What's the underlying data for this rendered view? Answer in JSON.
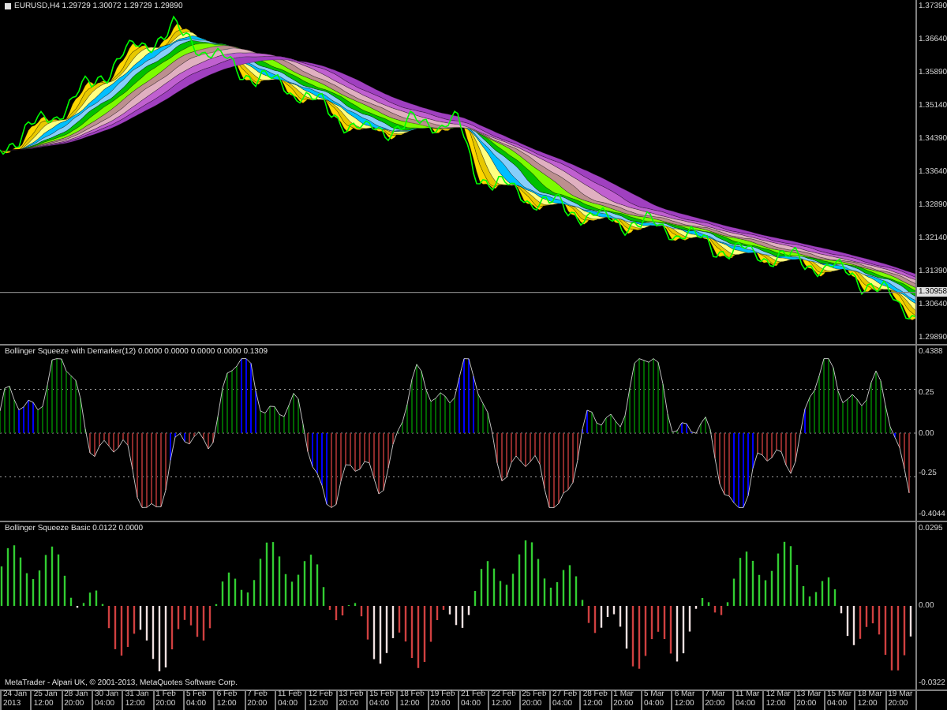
{
  "chart_window": {
    "title": "EURUSD,H4 1.29729 1.30072 1.29729 1.29890"
  },
  "panels": [
    {
      "kind": "price",
      "axis_labels": [
        "1.37390",
        "1.36640",
        "1.35890",
        "1.35140",
        "1.34390",
        "1.33640",
        "1.32890",
        "1.32140",
        "1.31390",
        "1.30640",
        "1.29890"
      ],
      "price_tag": "1.30958"
    },
    {
      "kind": "oscillator",
      "label": "Bollinger Squeeze with Demarker(12) 0.0000 0.0000 0.0000 0.0000 0.1309",
      "axis_labels": [
        "0.4388",
        "0.25",
        "0.00",
        "-0.25",
        "-0.4044"
      ]
    },
    {
      "kind": "histogram",
      "label": "Bollinger Squeeze Basic 0.0122 0.0000",
      "axis_labels": [
        "0.0295",
        "0.00",
        "-0.0322"
      ],
      "footer": "MetaTrader - Alpari UK, © 2001-2013, MetaQuotes Software Corp."
    }
  ],
  "time_axis": [
    "24 Jan 2013",
    "25 Jan 12:00",
    "28 Jan 20:00",
    "30 Jan 04:00",
    "31 Jan 12:00",
    "1 Feb 20:00",
    "5 Feb 04:00",
    "6 Feb 12:00",
    "7 Feb 20:00",
    "11 Feb 04:00",
    "12 Feb 12:00",
    "13 Feb 20:00",
    "15 Feb 04:00",
    "18 Feb 12:00",
    "19 Feb 20:00",
    "21 Feb 04:00",
    "22 Feb 12:00",
    "25 Feb 20:00",
    "27 Feb 04:00",
    "28 Feb 12:00",
    "1 Mar 20:00",
    "5 Mar 04:00",
    "6 Mar 12:00",
    "7 Mar 20:00",
    "11 Mar 04:00",
    "12 Mar 12:00",
    "13 Mar 20:00",
    "15 Mar 04:00",
    "18 Mar 12:00",
    "19 Mar 20:00"
  ]
}
